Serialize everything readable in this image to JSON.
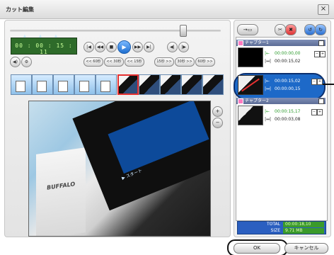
{
  "window": {
    "title": "カット編集",
    "close_symbol": "×"
  },
  "player": {
    "timecode": "00 : 00 : 15 : 11",
    "position_fraction": 0.82,
    "transport_icons": [
      "skip-start-icon",
      "step-back-icon",
      "stop-icon",
      "play-icon",
      "step-forward-icon",
      "skip-end-icon",
      "mark-in-icon",
      "mark-out-icon"
    ],
    "jump_buttons": [
      "<< 60秒",
      "<< 30秒",
      "<< 15秒",
      "15秒 >>",
      "30秒 >>",
      "60秒 >>"
    ]
  },
  "preview": {
    "brand": "BUFFALO",
    "screen_caption": "▶ スタート"
  },
  "chapters": [
    {
      "title": "チャプター1",
      "cuts": [
        {
          "in": "00:00:00,00",
          "duration": "00:00:15,02",
          "selected": false
        },
        {
          "in": "00:00:15,02",
          "duration": "00:00:00,15",
          "selected": true
        }
      ]
    },
    {
      "title": "チャプター2",
      "cuts": [
        {
          "in": "00:00:15,17",
          "duration": "00:00:03,08",
          "selected": false
        }
      ]
    }
  ],
  "totals": {
    "total_label": "TOTAL",
    "total_value": "00:00:18,10",
    "size_label": "SIZE",
    "size_value": "9.71 MB"
  },
  "buttons": {
    "ok": "OK",
    "cancel": "キャンセル"
  }
}
